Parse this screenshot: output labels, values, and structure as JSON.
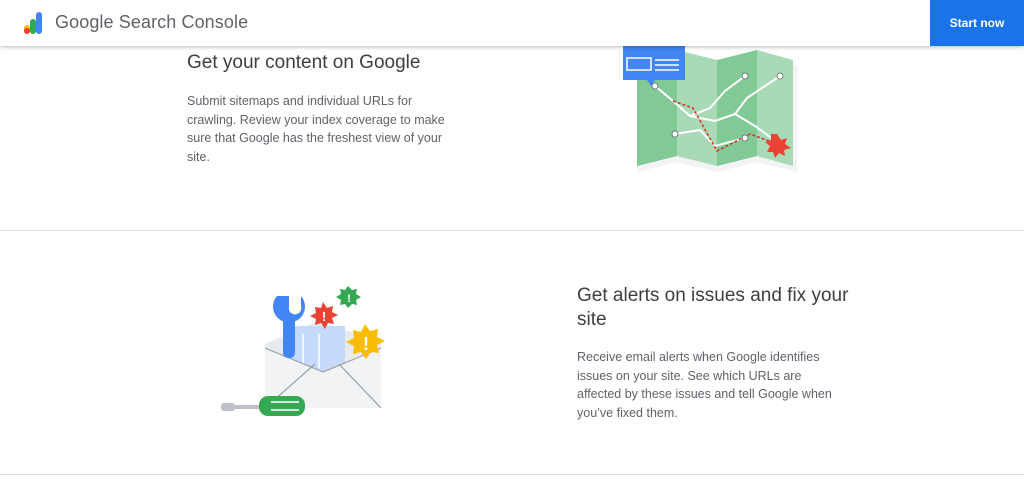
{
  "header": {
    "brand_name": "Google Search Console",
    "start_label": "Start now"
  },
  "sections": [
    {
      "title": "Get your content on Google",
      "description": "Submit sitemaps and individual URLs for crawling. Review your index coverage to make sure that Google has the freshest view of your site.",
      "illustration": "map-illustration"
    },
    {
      "title": "Get alerts on issues and fix your site",
      "description": "Receive email alerts when Google identifies issues on your site. See which URLs are affected by these issues and tell Google when you’ve fixed them.",
      "illustration": "email-alerts-illustration"
    }
  ],
  "colors": {
    "accent": "#1a73e8",
    "green": "#34a853",
    "red": "#ea4335",
    "yellow": "#fbbc04",
    "map_green": "#81c995"
  }
}
